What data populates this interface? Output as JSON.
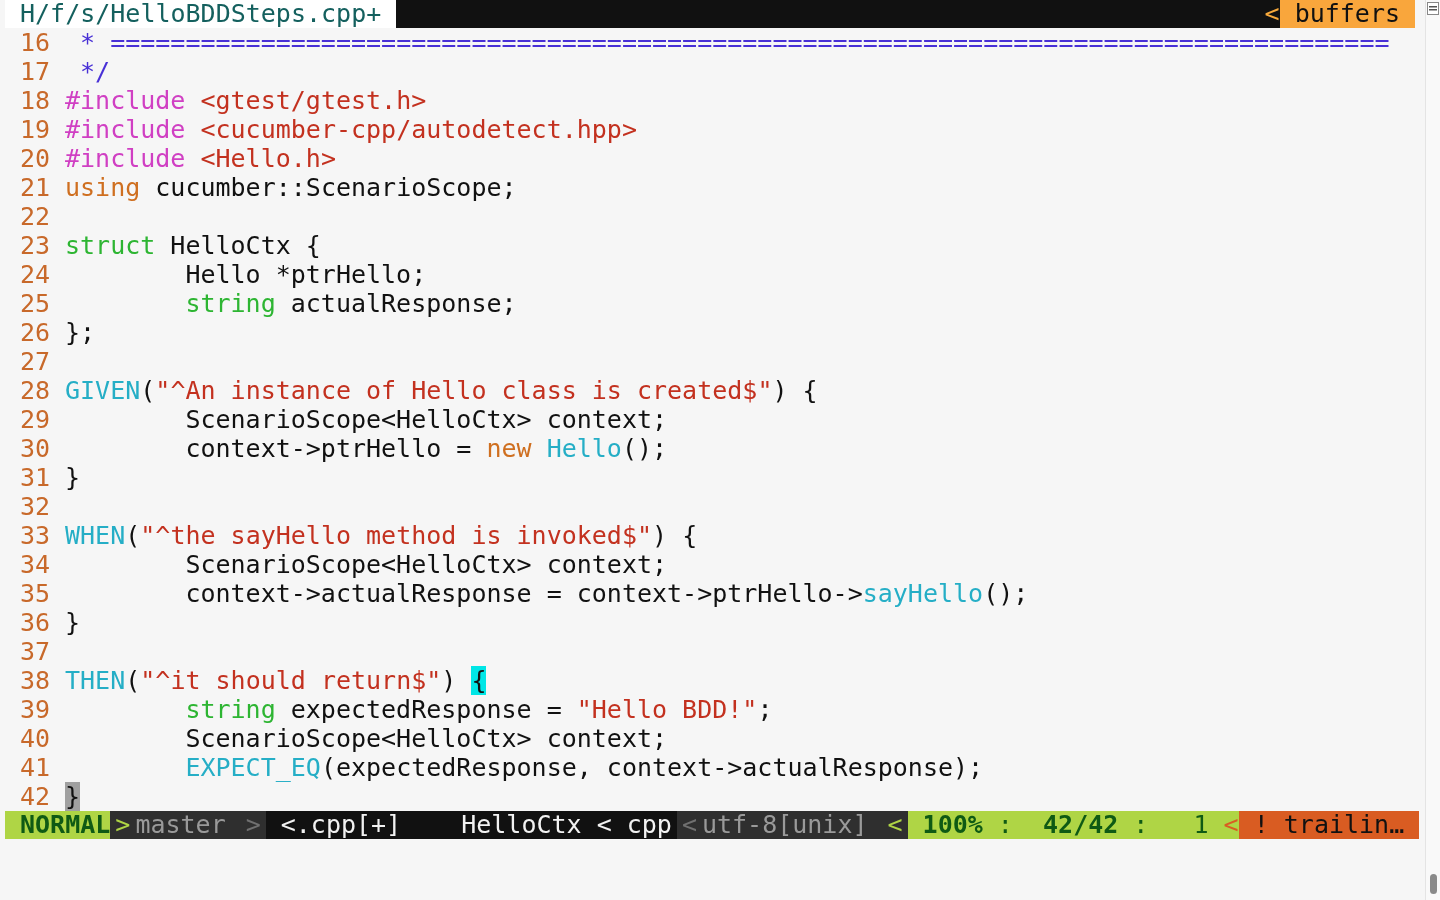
{
  "tabline": {
    "file_tab": "H/f/s/HelloBDDSteps.cpp+",
    "separator": "<",
    "buffers_label": "buffers"
  },
  "lines": [
    {
      "number": "16",
      "indent": false,
      "tokens": [
        {
          "text": " * =====================================================================================",
          "kind": "comment"
        }
      ]
    },
    {
      "number": "17",
      "indent": false,
      "tokens": [
        {
          "text": " */",
          "kind": "comment"
        }
      ]
    },
    {
      "number": "18",
      "indent": false,
      "tokens": [
        {
          "text": "#include",
          "kind": "preproc"
        },
        {
          "text": "<gtest/gtest.h>",
          "kind": "string",
          "space_before": true
        }
      ]
    },
    {
      "number": "19",
      "indent": false,
      "tokens": [
        {
          "text": "#include",
          "kind": "preproc"
        },
        {
          "text": "<cucumber-cpp/autodetect.hpp>",
          "kind": "string",
          "space_before": true
        }
      ]
    },
    {
      "number": "20",
      "indent": false,
      "tokens": [
        {
          "text": "#include",
          "kind": "preproc"
        },
        {
          "text": "<Hello.h>",
          "kind": "string",
          "space_before": true
        }
      ]
    },
    {
      "number": "21",
      "indent": false,
      "tokens": [
        {
          "text": "using",
          "kind": "keyword"
        },
        {
          "text": "cucumber::ScenarioScope;",
          "kind": "plain",
          "space_before": true
        }
      ]
    },
    {
      "number": "22"
    },
    {
      "number": "23",
      "indent": false,
      "tokens": [
        {
          "text": "struct",
          "kind": "type"
        },
        {
          "text": "HelloCtx {",
          "kind": "plain",
          "space_before": true
        }
      ]
    },
    {
      "number": "24",
      "indent": true,
      "tokens": [
        {
          "text": "Hello *ptrHello;",
          "kind": "plain"
        }
      ]
    },
    {
      "number": "25",
      "indent": true,
      "tokens": [
        {
          "text": "string",
          "kind": "type"
        },
        {
          "text": "actualResponse;",
          "kind": "plain",
          "space_before": true
        }
      ]
    },
    {
      "number": "26",
      "indent": false,
      "tokens": [
        {
          "text": "};",
          "kind": "plain"
        }
      ]
    },
    {
      "number": "27"
    },
    {
      "number": "28",
      "indent": false,
      "tokens": [
        {
          "text": "GIVEN",
          "kind": "func"
        },
        {
          "text": "(",
          "kind": "plain"
        },
        {
          "text": "\"^An instance of Hello class is created$\"",
          "kind": "string"
        },
        {
          "text": ") {",
          "kind": "plain"
        }
      ]
    },
    {
      "number": "29",
      "indent": true,
      "tokens": [
        {
          "text": "ScenarioScope<HelloCtx> context;",
          "kind": "plain"
        }
      ]
    },
    {
      "number": "30",
      "indent": true,
      "tokens": [
        {
          "text": "context->ptrHello =",
          "kind": "plain"
        },
        {
          "text": "new",
          "kind": "keyword",
          "space_before": true
        },
        {
          "text": "Hello",
          "kind": "func",
          "space_before": true
        },
        {
          "text": "();",
          "kind": "plain"
        }
      ]
    },
    {
      "number": "31",
      "indent": false,
      "tokens": [
        {
          "text": "}",
          "kind": "plain"
        }
      ]
    },
    {
      "number": "32"
    },
    {
      "number": "33",
      "indent": false,
      "tokens": [
        {
          "text": "WHEN",
          "kind": "func"
        },
        {
          "text": "(",
          "kind": "plain"
        },
        {
          "text": "\"^the sayHello method is invoked$\"",
          "kind": "string"
        },
        {
          "text": ") {",
          "kind": "plain"
        }
      ]
    },
    {
      "number": "34",
      "indent": true,
      "tokens": [
        {
          "text": "ScenarioScope<HelloCtx> context;",
          "kind": "plain"
        }
      ]
    },
    {
      "number": "35",
      "indent": true,
      "tokens": [
        {
          "text": "context->actualResponse = context->ptrHello->",
          "kind": "plain"
        },
        {
          "text": "sayHello",
          "kind": "func"
        },
        {
          "text": "();",
          "kind": "plain"
        }
      ]
    },
    {
      "number": "36",
      "indent": false,
      "tokens": [
        {
          "text": "}",
          "kind": "plain"
        }
      ]
    },
    {
      "number": "37"
    },
    {
      "number": "38",
      "indent": false,
      "tokens": [
        {
          "text": "THEN",
          "kind": "func"
        },
        {
          "text": "(",
          "kind": "plain"
        },
        {
          "text": "\"^it should return$\"",
          "kind": "string"
        },
        {
          "text": ") ",
          "kind": "plain"
        },
        {
          "text": "{",
          "kind": "match"
        }
      ]
    },
    {
      "number": "39",
      "indent": true,
      "tokens": [
        {
          "text": "string",
          "kind": "type"
        },
        {
          "text": "expectedResponse =",
          "kind": "plain",
          "space_before": true
        },
        {
          "text": "\"Hello BDD!\"",
          "kind": "string",
          "space_before": true
        },
        {
          "text": ";",
          "kind": "plain"
        }
      ]
    },
    {
      "number": "40",
      "indent": true,
      "tokens": [
        {
          "text": "ScenarioScope<HelloCtx> context;",
          "kind": "plain"
        }
      ]
    },
    {
      "number": "41",
      "indent": true,
      "tokens": [
        {
          "text": "EXPECT_EQ",
          "kind": "func"
        },
        {
          "text": "(expectedResponse, context->actualResponse);",
          "kind": "plain"
        }
      ]
    },
    {
      "number": "42",
      "indent": false,
      "tokens": [
        {
          "text": "}",
          "kind": "cursor"
        }
      ]
    }
  ],
  "status_bar": [
    {
      "text": "NORMAL",
      "kind": "mode"
    },
    {
      "text": ">",
      "kind": "arrow-green"
    },
    {
      "text": "master",
      "kind": "branch"
    },
    {
      "text": ">",
      "kind": "arrow-dim"
    },
    {
      "text": "<.cpp[+]",
      "kind": "file"
    },
    {
      "text": "HelloCtx < cpp",
      "kind": "filetype"
    },
    {
      "text": "<",
      "kind": "arrow-dim"
    },
    {
      "text": "utf-8[unix]",
      "kind": "encoding"
    },
    {
      "text": "<",
      "kind": "arrow-green"
    },
    {
      "text": "**100%** :  **42/42** :   1",
      "kind": "position"
    },
    {
      "text": "<",
      "kind": "arrow-red"
    },
    {
      "text": "! trailin…",
      "kind": "warning"
    }
  ]
}
